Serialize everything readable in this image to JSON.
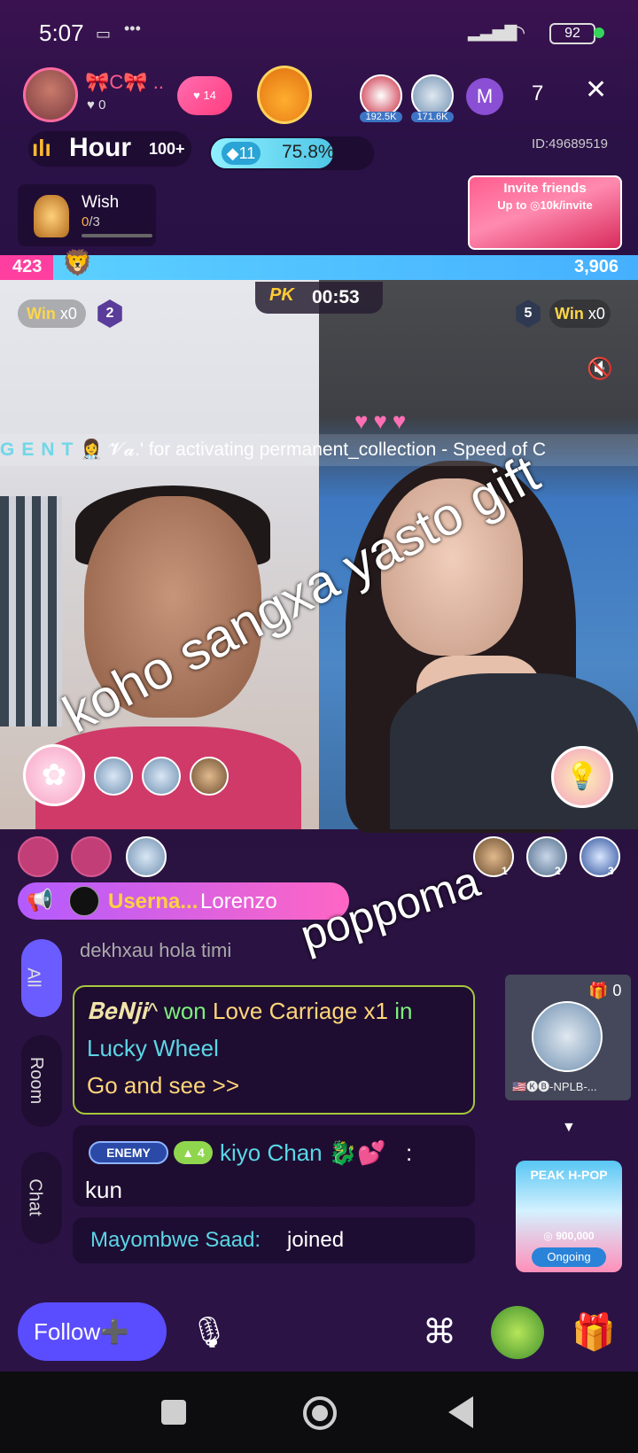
{
  "status_bar": {
    "time": "5:07",
    "battery": "92"
  },
  "header": {
    "host_name": "🎀C🎀 ..",
    "host_likes": "0",
    "heart_badge": "14",
    "viewers": [
      {
        "count": "192.5K"
      },
      {
        "count": "171.6K"
      }
    ],
    "viewer_letter": "M",
    "viewer_total": "7",
    "hour_label": "Hour",
    "hour_rank": "100+",
    "progress_gems": "11",
    "progress_percent": "75.8%",
    "progress_fraction": 0.758,
    "room_id": "ID:49689519"
  },
  "wish": {
    "title": "Wish",
    "current": "0",
    "total": "/3"
  },
  "invite": {
    "line1": "Invite friends",
    "line2": "Up to ◎10k/invite"
  },
  "pk": {
    "left_score": "423",
    "right_score": "3,906",
    "timer_label": "PK",
    "timer": "00:53",
    "left_win": {
      "label": "Win",
      "count": "x0",
      "rank": "2"
    },
    "right_win": {
      "label": "Win",
      "count": "x0",
      "rank": "5"
    },
    "ticker_gent": "GENT",
    "ticker_text": "👩‍⚕️ 𝓥𝓪.' for activating permanent_collection - Speed of C"
  },
  "chat": {
    "top_ranks": [
      "1",
      "2",
      "3"
    ],
    "announcement_user": "Userna...",
    "announcement_name": "Lorenzo",
    "tabs": [
      "All",
      "Room",
      "Chat"
    ],
    "faded_message": "dekhxau hola timi",
    "lucky": {
      "user": "𝐁𝐞𝐍𝐣𝐢^",
      "won": "won",
      "prize": "Love Carriage x1",
      "in": "in",
      "game": "Lucky Wheel",
      "cta": "Go and see >>"
    },
    "message2": {
      "badge": "ENEMY",
      "level": "▲ 4",
      "user": "kiyo Chan 🐉💕",
      "text": "kun"
    },
    "message3": {
      "user": "Mayombwe Saad:",
      "text": "joined"
    }
  },
  "side_card": {
    "gifts": "0",
    "name": "🇺🇸🅚🅑-NPLB-..."
  },
  "event": {
    "title": "PEAK H-POP",
    "amount": "◎ 900,000",
    "status": "Ongoing"
  },
  "bottom": {
    "follow": "Follow➕"
  },
  "overlay": {
    "line1": "koho sangxa yasto gift",
    "line2": "poppoma"
  }
}
